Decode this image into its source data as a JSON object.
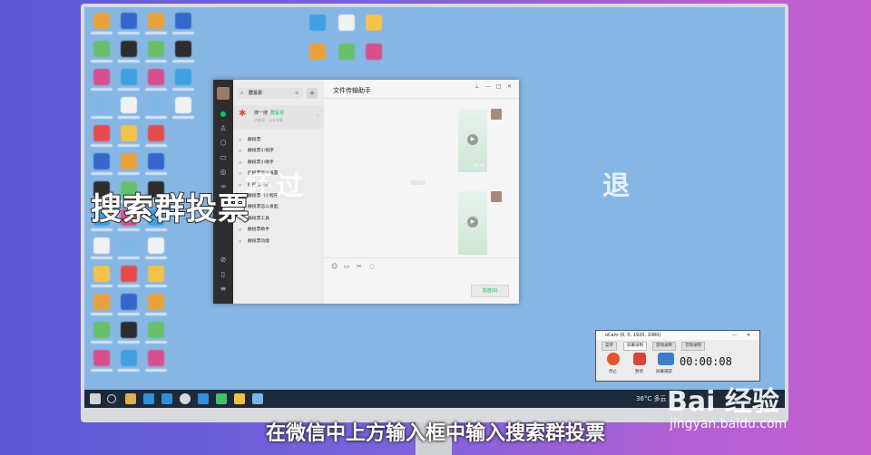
{
  "overlay": {
    "title": "搜索群投票",
    "faint_left": "坏过",
    "faint_right": "退",
    "subtitle": "在微信中上方输入框中输入搜索群投票"
  },
  "wechat": {
    "search_value": "群投票",
    "search_result_top": {
      "prefix": "搜一搜",
      "keyword": "群投票",
      "sub": "小程序、公众号等"
    },
    "results": [
      "群投票",
      "群投票小程序",
      "群投票小助手",
      "群投票怎么设置",
      "群投票在哪",
      "群投票的小程序",
      "群投票怎么发起",
      "群投票工具",
      "群投票助手",
      "群投票功能"
    ],
    "chat_title": "文件传输助手",
    "timestamp": "",
    "send_label": "发送(S)",
    "video_duration": "00:06"
  },
  "ocam": {
    "title": "oCam (0, 0, 1920, 1080)",
    "tabs": [
      "菜单",
      "屏幕录制",
      "游戏录制",
      "音频录制"
    ],
    "buttons": [
      "停止",
      "暂停",
      "屏幕捕获"
    ],
    "timer": "00:00:08"
  },
  "taskbar": {
    "weather": "36°C 多云"
  },
  "watermark": {
    "logo": "Bai 经验",
    "url": "jingyan.baidu.com"
  },
  "colors": {
    "wechat_green": "#07c160",
    "desktop_blue": "#86b6e4",
    "sidebar_dark": "#2e2e2e"
  }
}
